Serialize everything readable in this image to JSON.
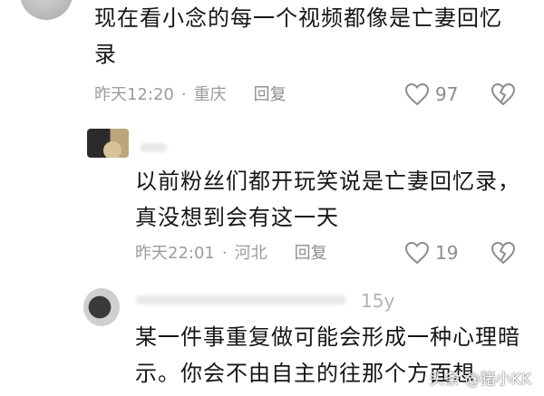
{
  "comments": [
    {
      "text_lines": [
        "现在看小念的每一个视频都像是亡妻回忆",
        "录"
      ],
      "time": "昨天12:20",
      "location": "重庆",
      "reply_label": "回复",
      "likes": "97"
    },
    {
      "text_lines": [
        "以前粉丝们都开玩笑说是亡妻回忆录，",
        "真没想到会有这一天"
      ],
      "time": "昨天22:01",
      "location": "河北",
      "reply_label": "回复",
      "likes": "19"
    },
    {
      "time": "15y",
      "text_lines": [
        "某一件事重复做可能会形成一种心理暗",
        "示。你会不由自主的往那个方面想"
      ]
    }
  ],
  "separator": "·",
  "watermark": "头条 @猪小KK",
  "colors": {
    "text": "#161616",
    "meta": "#9c9c9c",
    "icon": "#8c8c8c"
  },
  "icons": {
    "like": "heart-icon",
    "dislike": "broken-heart-icon"
  }
}
